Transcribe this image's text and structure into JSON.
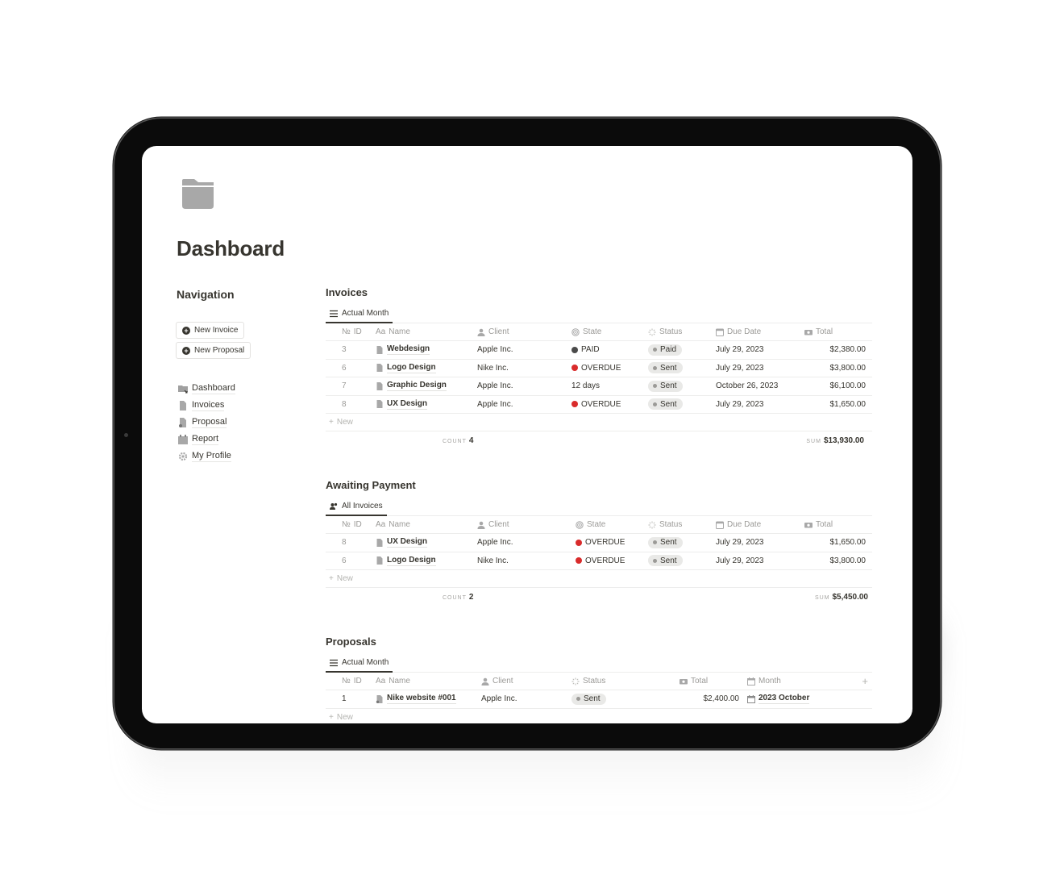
{
  "page": {
    "title": "Dashboard",
    "icon": "folder-icon"
  },
  "navigation": {
    "title": "Navigation",
    "buttons": [
      {
        "label": "New Invoice",
        "icon": "plus-circle-icon"
      },
      {
        "label": "New Proposal",
        "icon": "plus-circle-icon"
      }
    ],
    "items": [
      {
        "label": "Dashboard",
        "icon": "folder-link-icon"
      },
      {
        "label": "Invoices",
        "icon": "document-icon"
      },
      {
        "label": "Proposal",
        "icon": "proposal-icon"
      },
      {
        "label": "Report",
        "icon": "calendar-icon"
      },
      {
        "label": "My Profile",
        "icon": "gear-icon"
      }
    ]
  },
  "invoices": {
    "title": "Invoices",
    "view_tab": "Actual Month",
    "columns": {
      "id": "ID",
      "id_prefix": "№",
      "name": "Name",
      "name_prefix": "Aa",
      "client": "Client",
      "state": "State",
      "status": "Status",
      "due_date": "Due Date",
      "total": "Total"
    },
    "rows": [
      {
        "id": "3",
        "name": "Webdesign",
        "client": "Apple Inc.",
        "state": "PAID",
        "state_color": "#4a4a4a",
        "status": "Paid",
        "due_date": "July 29, 2023",
        "total": "$2,380.00"
      },
      {
        "id": "6",
        "name": "Logo Design",
        "client": "Nike Inc.",
        "state": "OVERDUE",
        "state_color": "#d92b2b",
        "status": "Sent",
        "due_date": "July 29, 2023",
        "total": "$3,800.00"
      },
      {
        "id": "7",
        "name": "Graphic Design",
        "client": "Apple Inc.",
        "state": "12 days",
        "state_color": "",
        "status": "Sent",
        "due_date": "October 26, 2023",
        "total": "$6,100.00"
      },
      {
        "id": "8",
        "name": "UX Design",
        "client": "Apple Inc.",
        "state": "OVERDUE",
        "state_color": "#d92b2b",
        "status": "Sent",
        "due_date": "July 29, 2023",
        "total": "$1,650.00"
      }
    ],
    "new_label": "New",
    "count_label": "COUNT",
    "count_value": "4",
    "sum_label": "SUM",
    "sum_value": "$13,930.00"
  },
  "awaiting": {
    "title": "Awaiting Payment",
    "view_tab": "All Invoices",
    "columns": {
      "id": "ID",
      "id_prefix": "№",
      "name": "Name",
      "name_prefix": "Aa",
      "client": "Client",
      "state": "State",
      "status": "Status",
      "due_date": "Due Date",
      "total": "Total"
    },
    "rows": [
      {
        "id": "8",
        "name": "UX Design",
        "client": "Apple Inc.",
        "state": "OVERDUE",
        "state_color": "#d92b2b",
        "status": "Sent",
        "due_date": "July 29, 2023",
        "total": "$1,650.00"
      },
      {
        "id": "6",
        "name": "Logo Design",
        "client": "Nike Inc.",
        "state": "OVERDUE",
        "state_color": "#d92b2b",
        "status": "Sent",
        "due_date": "July 29, 2023",
        "total": "$3,800.00"
      }
    ],
    "new_label": "New",
    "count_label": "COUNT",
    "count_value": "2",
    "sum_label": "SUM",
    "sum_value": "$5,450.00"
  },
  "proposals": {
    "title": "Proposals",
    "view_tab": "Actual Month",
    "columns": {
      "id": "ID",
      "id_prefix": "№",
      "name": "Name",
      "name_prefix": "Aa",
      "client": "Client",
      "status": "Status",
      "total": "Total",
      "month": "Month",
      "add": "+"
    },
    "rows": [
      {
        "id": "1",
        "name": "Nike website #001",
        "client": "Apple Inc.",
        "status": "Sent",
        "total": "$2,400.00",
        "month": "2023 October"
      }
    ],
    "new_label": "New"
  },
  "colors": {
    "overdue": "#d92b2b",
    "paid": "#4a4a4a",
    "text": "#37352f",
    "muted": "#9b9a97"
  }
}
